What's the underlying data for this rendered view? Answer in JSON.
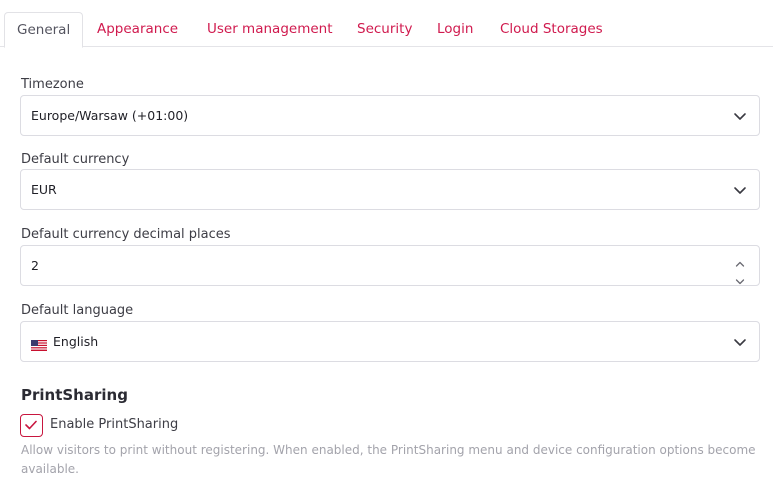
{
  "tabs": [
    {
      "label": "General",
      "active": true
    },
    {
      "label": "Appearance",
      "active": false
    },
    {
      "label": "User management",
      "active": false
    },
    {
      "label": "Security",
      "active": false
    },
    {
      "label": "Login",
      "active": false
    },
    {
      "label": "Cloud Storages",
      "active": false
    }
  ],
  "timezone": {
    "label": "Timezone",
    "value": "Europe/Warsaw (+01:00)",
    "icon": "chevron-down-icon"
  },
  "currency": {
    "label": "Default currency",
    "value": "EUR",
    "icon": "chevron-down-icon"
  },
  "decimals": {
    "label": "Default currency decimal places",
    "value": "2",
    "icons": [
      "spin-up-icon",
      "spin-down-icon"
    ]
  },
  "language": {
    "label": "Default language",
    "value": "English",
    "flag": "us-flag-icon",
    "icon": "chevron-down-icon"
  },
  "printsharing": {
    "title": "PrintSharing",
    "checkbox_label": "Enable PrintSharing",
    "checked": true,
    "help": "Allow visitors to print without registering. When enabled, the PrintSharing menu and device configuration options become available."
  },
  "colors": {
    "accent": "#d01a4e",
    "border": "#dcdce2",
    "muted": "#a3a3ab"
  }
}
